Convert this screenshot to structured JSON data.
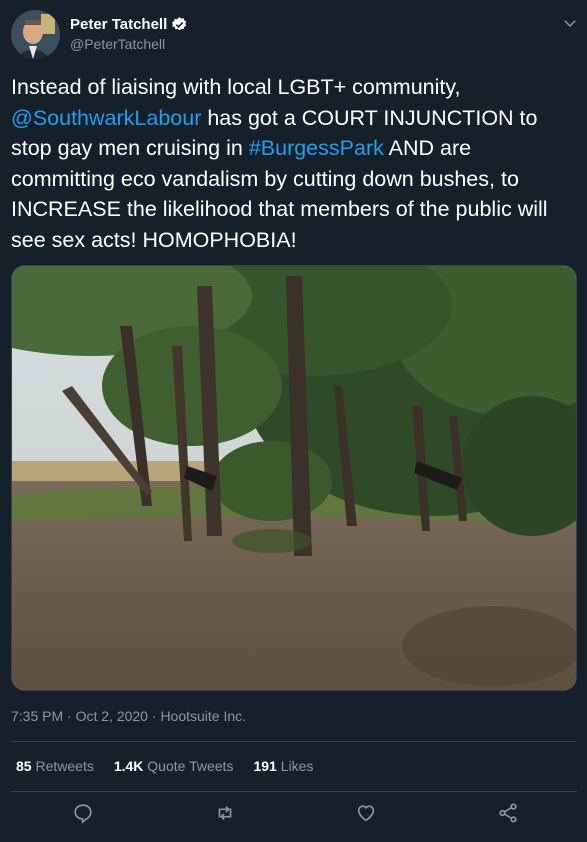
{
  "author": {
    "display_name": "Peter Tatchell",
    "handle": "@PeterTatchell"
  },
  "tweet": {
    "part1": "Instead of liaising with local LGBT+ community, ",
    "mention": "@SouthwarkLabour",
    "part2": " has got a COURT INJUNCTION to stop gay men cruising in ",
    "hashtag": "#BurgessPark",
    "part3": " AND are committing eco vandalism by cutting down bushes, to INCREASE the likelihood that members of the public will see sex acts! HOMOPHOBIA!"
  },
  "meta": {
    "time": "7:35 PM",
    "date": "Oct 2, 2020",
    "source": "Hootsuite Inc.",
    "separator": "·"
  },
  "stats": {
    "retweets_count": "85",
    "retweets_label": "Retweets",
    "quotes_count": "1.4K",
    "quotes_label": "Quote Tweets",
    "likes_count": "191",
    "likes_label": "Likes"
  },
  "colors": {
    "background": "#15202b",
    "link": "#1da1f2",
    "secondary_text": "#8899a6",
    "divider": "#38444d"
  },
  "icons": [
    "verified-badge-icon",
    "chevron-down-icon",
    "reply-icon",
    "retweet-icon",
    "like-icon",
    "share-icon"
  ]
}
